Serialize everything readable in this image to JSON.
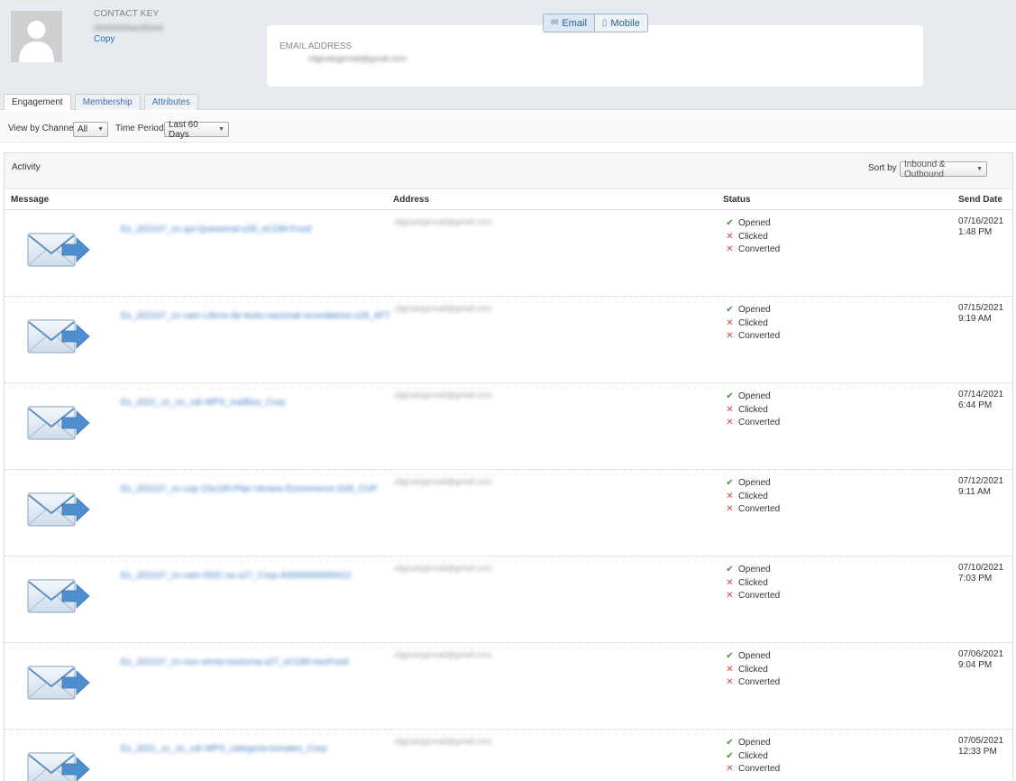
{
  "contact": {
    "key_label": "CONTACT KEY",
    "key_value": "00000000ae3f2d41",
    "copy_label": "Copy"
  },
  "email": {
    "label": "EMAIL ADDRESS",
    "value": "cliginalsgirmail@gmail.com"
  },
  "channels": {
    "email": "Email",
    "mobile": "Mobile"
  },
  "tabs": [
    "Engagement",
    "Membership",
    "Attributes"
  ],
  "filters": {
    "channel_label": "View by Channel",
    "channel_value": "All",
    "period_label": "Time Period",
    "period_value": "Last 60 Days"
  },
  "activity": {
    "title": "Activity",
    "sort_label": "Sort by",
    "sort_value": "Inbound & Outbound",
    "columns": {
      "message": "Message",
      "address": "Address",
      "status": "Status",
      "send_date": "Send Date"
    },
    "status_labels": {
      "opened": "Opened",
      "clicked": "Clicked",
      "converted": "Converted"
    },
    "rows": [
      {
        "message": "Es_202107_cc-qui-Quincenal-s28_eCOM-Food",
        "address": "cliginalsgirmail@gmail.com",
        "opened": true,
        "clicked": false,
        "converted": false,
        "date": "07/16/2021",
        "time": "1:48 PM"
      },
      {
        "message": "Es_202107_cc-cam-Libros-de-texto-nacional-recordatorio-s28_ATT",
        "address": "cliginalsgirmail@gmail.com",
        "opened": true,
        "clicked": false,
        "converted": false,
        "date": "07/15/2021",
        "time": "9:19 AM"
      },
      {
        "message": "Es_2021_cc_nc_cdr-MPS_mailbox_Corp",
        "address": "cliginalsgirmail@gmail.com",
        "opened": true,
        "clicked": false,
        "converted": false,
        "date": "07/14/2021",
        "time": "6:44 PM"
      },
      {
        "message": "Es_202107_cc-cup-15x100-Plan-Verano-Ecommerce-S28_CUP",
        "address": "cliginalsgirmail@gmail.com",
        "opened": true,
        "clicked": false,
        "converted": false,
        "date": "07/12/2021",
        "time": "9:11 AM"
      },
      {
        "message": "Es_202107_cc-cam-DDC-ss-s27_Corp-A0000000000412",
        "address": "cliginalsgirmail@gmail.com",
        "opened": true,
        "clicked": false,
        "converted": false,
        "date": "07/10/2021",
        "time": "7:03 PM"
      },
      {
        "message": "Es_202107_cc-oso-venta-nocturna-s27_eCOM-nonFood",
        "address": "cliginalsgirmail@gmail.com",
        "opened": true,
        "clicked": false,
        "converted": false,
        "date": "07/06/2021",
        "time": "9:04 PM"
      },
      {
        "message": "Es_2021_cc_nc_cdr-MPS_categoria-tomates_Corp",
        "address": "cliginalsgirmail@gmail.com",
        "opened": true,
        "clicked": true,
        "converted": false,
        "date": "07/05/2021",
        "time": "12:33 PM"
      }
    ]
  }
}
